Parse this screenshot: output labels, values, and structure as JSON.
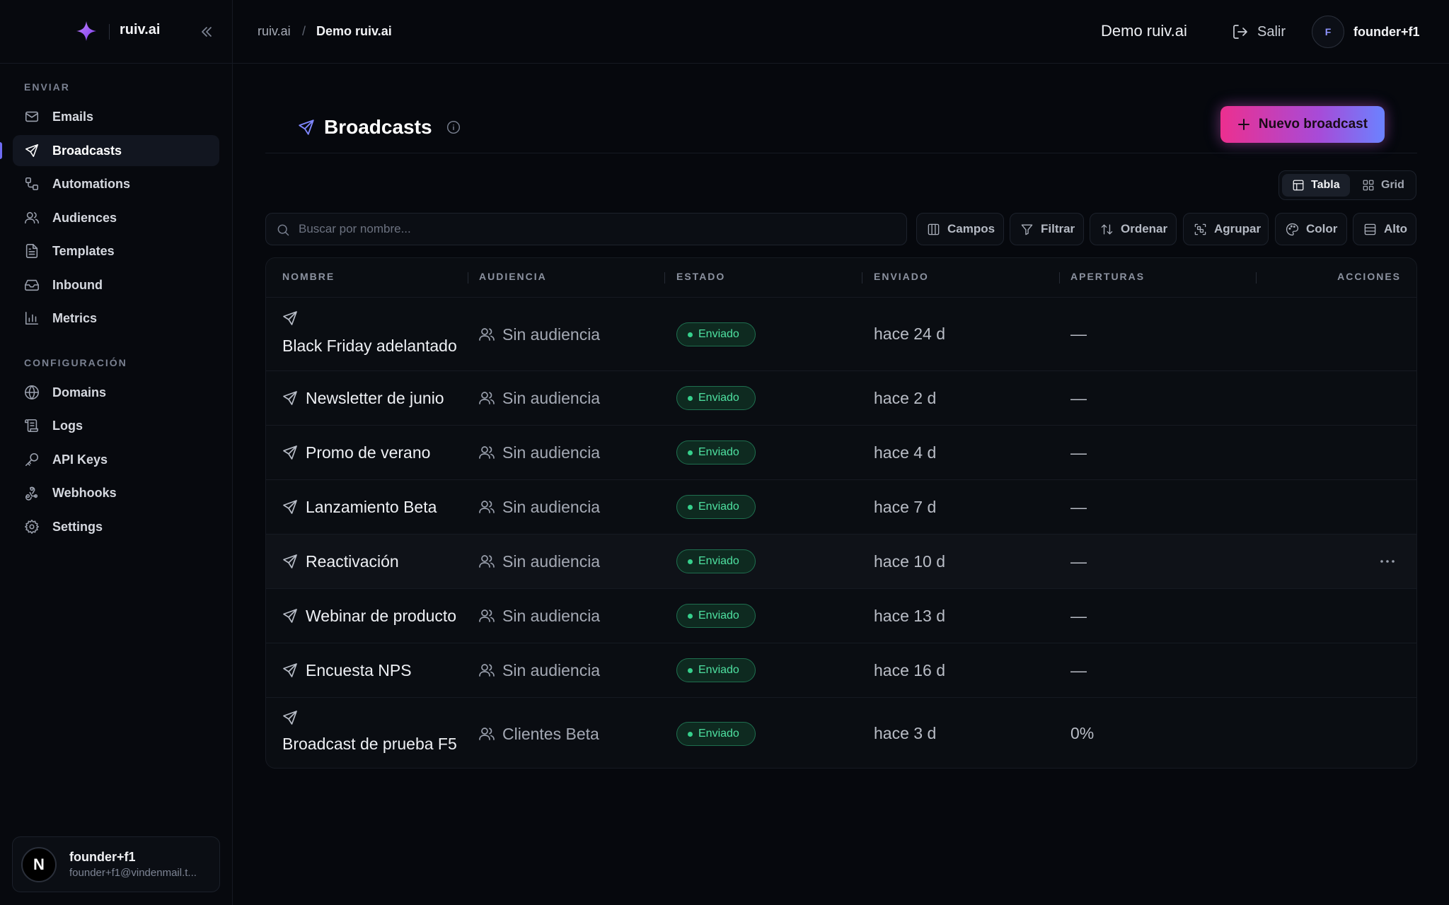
{
  "brand": {
    "name": "ruiv.ai"
  },
  "sidebar": {
    "section_send": "ENVIAR",
    "section_config": "CONFIGURACIÓN",
    "items": [
      {
        "label": "Emails",
        "icon": "mail-icon"
      },
      {
        "label": "Broadcasts",
        "icon": "send-icon",
        "active": true
      },
      {
        "label": "Automations",
        "icon": "workflow-icon"
      },
      {
        "label": "Audiences",
        "icon": "users-icon"
      },
      {
        "label": "Templates",
        "icon": "file-text-icon"
      },
      {
        "label": "Inbound",
        "icon": "inbox-icon"
      },
      {
        "label": "Metrics",
        "icon": "bar-chart-icon"
      }
    ],
    "config_items": [
      {
        "label": "Domains",
        "icon": "globe-icon"
      },
      {
        "label": "Logs",
        "icon": "scroll-icon"
      },
      {
        "label": "API Keys",
        "icon": "key-icon"
      },
      {
        "label": "Webhooks",
        "icon": "webhook-icon"
      },
      {
        "label": "Settings",
        "icon": "gear-icon"
      }
    ],
    "user": {
      "initial": "N",
      "name": "founder+f1",
      "email": "founder+f1@vindenmail.t..."
    }
  },
  "topbar": {
    "breadcrumb_root": "ruiv.ai",
    "breadcrumb_sep": "/",
    "breadcrumb_current": "Demo ruiv.ai",
    "workspace": "Demo ruiv.ai",
    "logout_label": "Salir",
    "user_initial": "F",
    "user_name": "founder+f1"
  },
  "main": {
    "title": "Broadcasts",
    "new_button": "Nuevo broadcast",
    "view_table": "Tabla",
    "view_grid": "Grid",
    "search_placeholder": "Buscar por nombre...",
    "tools": {
      "fields": "Campos",
      "filter": "Filtrar",
      "sort": "Ordenar",
      "group": "Agrupar",
      "color": "Color",
      "height": "Alto"
    }
  },
  "table": {
    "columns": [
      "NOMBRE",
      "AUDIENCIA",
      "ESTADO",
      "ENVIADO",
      "APERTURAS",
      "ACCIONES"
    ],
    "rows": [
      {
        "name": "Black Friday adelantado",
        "audience": "Sin audiencia",
        "status": "Enviado",
        "sent": "hace 24 d",
        "opens": "—"
      },
      {
        "name": "Newsletter de junio",
        "audience": "Sin audiencia",
        "status": "Enviado",
        "sent": "hace 2 d",
        "opens": "—"
      },
      {
        "name": "Promo de verano",
        "audience": "Sin audiencia",
        "status": "Enviado",
        "sent": "hace 4 d",
        "opens": "—"
      },
      {
        "name": "Lanzamiento Beta",
        "audience": "Sin audiencia",
        "status": "Enviado",
        "sent": "hace 7 d",
        "opens": "—"
      },
      {
        "name": "Reactivación",
        "audience": "Sin audiencia",
        "status": "Enviado",
        "sent": "hace 10 d",
        "opens": "—"
      },
      {
        "name": "Webinar de producto",
        "audience": "Sin audiencia",
        "status": "Enviado",
        "sent": "hace 13 d",
        "opens": "—"
      },
      {
        "name": "Encuesta NPS",
        "audience": "Sin audiencia",
        "status": "Enviado",
        "sent": "hace 16 d",
        "opens": "—"
      },
      {
        "name": "Broadcast de prueba F5",
        "audience": "Clientes Beta",
        "status": "Enviado",
        "sent": "hace 3 d",
        "opens": "0%"
      }
    ]
  },
  "colors": {
    "accent": "#6f6cf3",
    "status_sent": "#36d08c",
    "button_gradient_start": "#ec2f8f",
    "button_gradient_end": "#6b82ff"
  }
}
